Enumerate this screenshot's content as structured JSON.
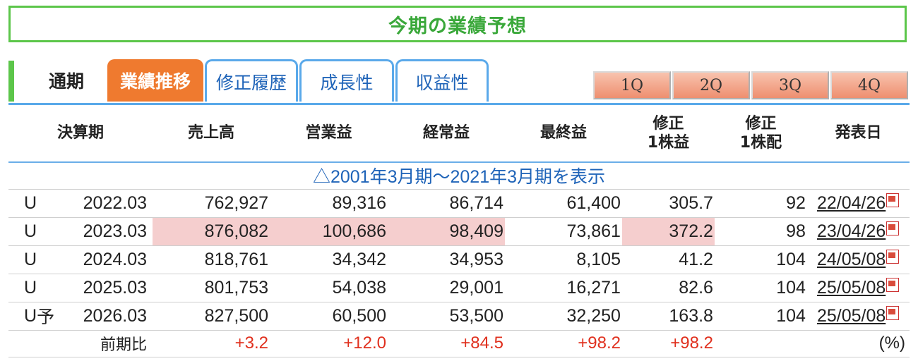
{
  "title": "今期の業績予想",
  "tabs": {
    "tsuki": "通期",
    "active": "業績推移",
    "t1": "修正履歴",
    "t2": "成長性",
    "t3": "収益性"
  },
  "quarters": [
    "1Q",
    "2Q",
    "3Q",
    "4Q"
  ],
  "headers": {
    "period": "決算期",
    "sales": "売上高",
    "op": "営業益",
    "ord": "経常益",
    "net": "最終益",
    "eps_line1": "修正",
    "eps_line2": "1株益",
    "div_line1": "修正",
    "div_line2": "1株配",
    "date": "発表日"
  },
  "toggle": "△2001年3月期〜2021年3月期を表示",
  "rows": [
    {
      "flag": "U",
      "pre": "",
      "period": "2022.03",
      "sales": "762,927",
      "op": "89,316",
      "ord": "86,714",
      "net": "61,400",
      "eps": "305.7",
      "div": "92",
      "date": "22/04/26"
    },
    {
      "flag": "U",
      "pre": "",
      "period": "2023.03",
      "sales": "876,082",
      "op": "100,686",
      "ord": "98,409",
      "net": "73,861",
      "eps": "372.2",
      "div": "98",
      "date": "23/04/26"
    },
    {
      "flag": "U",
      "pre": "",
      "period": "2024.03",
      "sales": "818,761",
      "op": "34,342",
      "ord": "34,953",
      "net": "8,105",
      "eps": "41.2",
      "div": "104",
      "date": "24/05/08"
    },
    {
      "flag": "U",
      "pre": "",
      "period": "2025.03",
      "sales": "801,753",
      "op": "54,038",
      "ord": "29,001",
      "net": "16,271",
      "eps": "82.6",
      "div": "104",
      "date": "25/05/08"
    },
    {
      "flag": "U",
      "pre": "予",
      "period": "2026.03",
      "sales": "827,500",
      "op": "60,500",
      "ord": "53,500",
      "net": "32,250",
      "eps": "163.8",
      "div": "104",
      "date": "25/05/08"
    }
  ],
  "comparison": {
    "label": "前期比",
    "sales": "+3.2",
    "op": "+12.0",
    "ord": "+84.5",
    "net": "+98.2",
    "eps": "+98.2",
    "unit": "(%)"
  },
  "colors": {
    "accent_green": "#5cc64a",
    "tab_orange": "#ef7a2f",
    "link_blue": "#1e63b8",
    "highlight_pink": "#f5cece",
    "positive_red": "#e0301e"
  }
}
